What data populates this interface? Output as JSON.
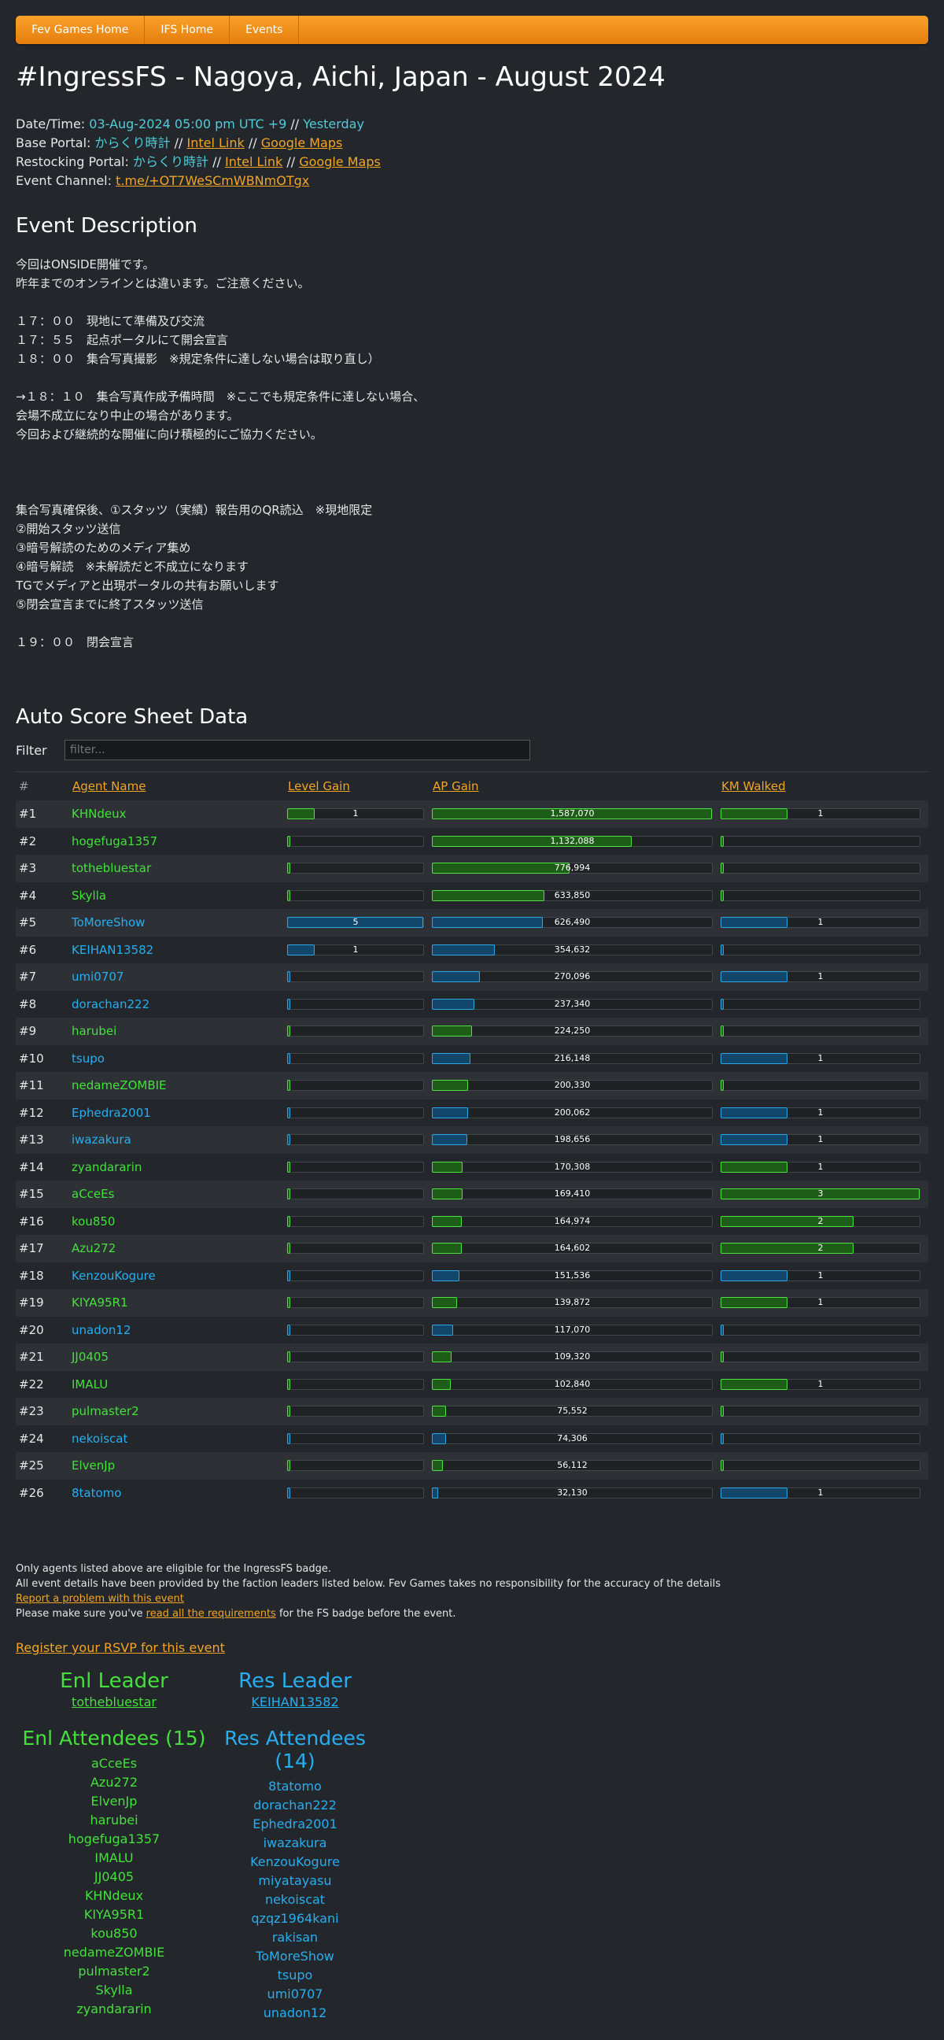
{
  "nav": [
    "Fev Games Home",
    "IFS Home",
    "Events"
  ],
  "title": "#IngressFS - Nagoya, Aichi, Japan - August 2024",
  "meta": {
    "datetime_label": "Date/Time:",
    "datetime_value": "03-Aug-2024 05:00 pm UTC +9",
    "sep": "//",
    "relative": "Yesterday",
    "base_label": "Base Portal:",
    "base_portal": "からくり時計",
    "intel_link": "Intel Link",
    "maps_link": "Google Maps",
    "restock_label": "Restocking Portal:",
    "restock_portal": "からくり時計",
    "channel_label": "Event Channel:",
    "channel_link": "t.me/+OT7WeSCmWBNmOTgx"
  },
  "description_heading": "Event Description",
  "description": "今回はONSIDE開催です。\n昨年までのオンラインとは違います。ご注意ください。\n\n１７：００　現地にて準備及び交流\n１７：５５　起点ポータルにて開会宣言\n１８：００　集合写真撮影　※規定条件に達しない場合は取り直し）\n\n→１８：１０　集合写真作成予備時間　※ここでも規定条件に達しない場合、\n会場不成立になり中止の場合があります。\n今回および継続的な開催に向け積極的にご協力ください。\n\n\n\n集合写真確保後、①スタッツ（実績）報告用のQR読込　※現地限定\n②開始スタッツ送信\n③暗号解読のためのメディア集め\n④暗号解読　※未解読だと不成立になります\nTGでメディアと出現ポータルの共有お願いします\n⑤閉会宣言までに終了スタッツ送信\n\n１９：００　閉会宣言",
  "score": {
    "heading": "Auto Score Sheet Data",
    "filter_label": "Filter",
    "filter_placeholder": "filter...",
    "columns": [
      "#",
      "Agent Name",
      "Level Gain",
      "AP Gain",
      "KM Walked"
    ],
    "max_level": 5,
    "max_ap": 1587070,
    "max_km": 3,
    "rows": [
      {
        "rank": "#1",
        "name": "KHNdeux",
        "faction": "enl",
        "level": 1,
        "ap": 1587070,
        "ap_label": "1,587,070",
        "km": 1
      },
      {
        "rank": "#2",
        "name": "hogefuga1357",
        "faction": "enl",
        "level": 0,
        "ap": 1132088,
        "ap_label": "1,132,088",
        "km": 0
      },
      {
        "rank": "#3",
        "name": "tothebluestar",
        "faction": "enl",
        "level": 0,
        "ap": 776994,
        "ap_label": "776,994",
        "km": 0
      },
      {
        "rank": "#4",
        "name": "Skylla",
        "faction": "enl",
        "level": 0,
        "ap": 633850,
        "ap_label": "633,850",
        "km": 0
      },
      {
        "rank": "#5",
        "name": "ToMoreShow",
        "faction": "res",
        "level": 5,
        "ap": 626490,
        "ap_label": "626,490",
        "km": 1
      },
      {
        "rank": "#6",
        "name": "KEIHAN13582",
        "faction": "res",
        "level": 1,
        "ap": 354632,
        "ap_label": "354,632",
        "km": 0
      },
      {
        "rank": "#7",
        "name": "umi0707",
        "faction": "res",
        "level": 0,
        "ap": 270096,
        "ap_label": "270,096",
        "km": 1
      },
      {
        "rank": "#8",
        "name": "dorachan222",
        "faction": "res",
        "level": 0,
        "ap": 237340,
        "ap_label": "237,340",
        "km": 0
      },
      {
        "rank": "#9",
        "name": "harubei",
        "faction": "enl",
        "level": 0,
        "ap": 224250,
        "ap_label": "224,250",
        "km": 0
      },
      {
        "rank": "#10",
        "name": "tsupo",
        "faction": "res",
        "level": 0,
        "ap": 216148,
        "ap_label": "216,148",
        "km": 1
      },
      {
        "rank": "#11",
        "name": "nedameZOMBIE",
        "faction": "enl",
        "level": 0,
        "ap": 200330,
        "ap_label": "200,330",
        "km": 0
      },
      {
        "rank": "#12",
        "name": "Ephedra2001",
        "faction": "res",
        "level": 0,
        "ap": 200062,
        "ap_label": "200,062",
        "km": 1
      },
      {
        "rank": "#13",
        "name": "iwazakura",
        "faction": "res",
        "level": 0,
        "ap": 198656,
        "ap_label": "198,656",
        "km": 1
      },
      {
        "rank": "#14",
        "name": "zyandararin",
        "faction": "enl",
        "level": 0,
        "ap": 170308,
        "ap_label": "170,308",
        "km": 1
      },
      {
        "rank": "#15",
        "name": "aCceEs",
        "faction": "enl",
        "level": 0,
        "ap": 169410,
        "ap_label": "169,410",
        "km": 3
      },
      {
        "rank": "#16",
        "name": "kou850",
        "faction": "enl",
        "level": 0,
        "ap": 164974,
        "ap_label": "164,974",
        "km": 2
      },
      {
        "rank": "#17",
        "name": "Azu272",
        "faction": "enl",
        "level": 0,
        "ap": 164602,
        "ap_label": "164,602",
        "km": 2
      },
      {
        "rank": "#18",
        "name": "KenzouKogure",
        "faction": "res",
        "level": 0,
        "ap": 151536,
        "ap_label": "151,536",
        "km": 1
      },
      {
        "rank": "#19",
        "name": "KIYA95R1",
        "faction": "enl",
        "level": 0,
        "ap": 139872,
        "ap_label": "139,872",
        "km": 1
      },
      {
        "rank": "#20",
        "name": "unadon12",
        "faction": "res",
        "level": 0,
        "ap": 117070,
        "ap_label": "117,070",
        "km": 0
      },
      {
        "rank": "#21",
        "name": "JJ0405",
        "faction": "enl",
        "level": 0,
        "ap": 109320,
        "ap_label": "109,320",
        "km": 0
      },
      {
        "rank": "#22",
        "name": "IMALU",
        "faction": "enl",
        "level": 0,
        "ap": 102840,
        "ap_label": "102,840",
        "km": 1
      },
      {
        "rank": "#23",
        "name": "pulmaster2",
        "faction": "enl",
        "level": 0,
        "ap": 75552,
        "ap_label": "75,552",
        "km": 0
      },
      {
        "rank": "#24",
        "name": "nekoiscat",
        "faction": "res",
        "level": 0,
        "ap": 74306,
        "ap_label": "74,306",
        "km": 0
      },
      {
        "rank": "#25",
        "name": "ElvenJp",
        "faction": "enl",
        "level": 0,
        "ap": 56112,
        "ap_label": "56,112",
        "km": 0
      },
      {
        "rank": "#26",
        "name": "8tatomo",
        "faction": "res",
        "level": 0,
        "ap": 32130,
        "ap_label": "32,130",
        "km": 1
      }
    ]
  },
  "footer": {
    "line1": "Only agents listed above are eligible for the IngressFS badge.",
    "line2": "All event details have been provided by the faction leaders listed below. Fev Games takes no responsibility for the accuracy of the details",
    "report_link": "Report a problem with this event",
    "req_prefix": "Please make sure you've",
    "req_link": "read all the requirements",
    "req_suffix": "for the FS badge before the event.",
    "rsvp_link": "Register your RSVP for this event"
  },
  "teams": {
    "enl": {
      "leader_heading": "Enl Leader",
      "leader": "tothebluestar",
      "attendees_heading": "Enl Attendees (15)",
      "attendees": [
        "aCceEs",
        "Azu272",
        "ElvenJp",
        "harubei",
        "hogefuga1357",
        "IMALU",
        "JJ0405",
        "KHNdeux",
        "KIYA95R1",
        "kou850",
        "nedameZOMBIE",
        "pulmaster2",
        "Skylla",
        "zyandararin"
      ]
    },
    "res": {
      "leader_heading": "Res Leader",
      "leader": "KEIHAN13582",
      "attendees_heading": "Res Attendees (14)",
      "attendees": [
        "8tatomo",
        "dorachan222",
        "Ephedra2001",
        "iwazakura",
        "KenzouKogure",
        "miyatayasu",
        "nekoiscat",
        "qzqz1964kani",
        "rakisan",
        "ToMoreShow",
        "tsupo",
        "umi0707",
        "unadon12"
      ]
    }
  },
  "colors": {
    "enl": "#44e03c",
    "res": "#27aef0",
    "accent": "#f2a524",
    "background": "#23272b"
  }
}
